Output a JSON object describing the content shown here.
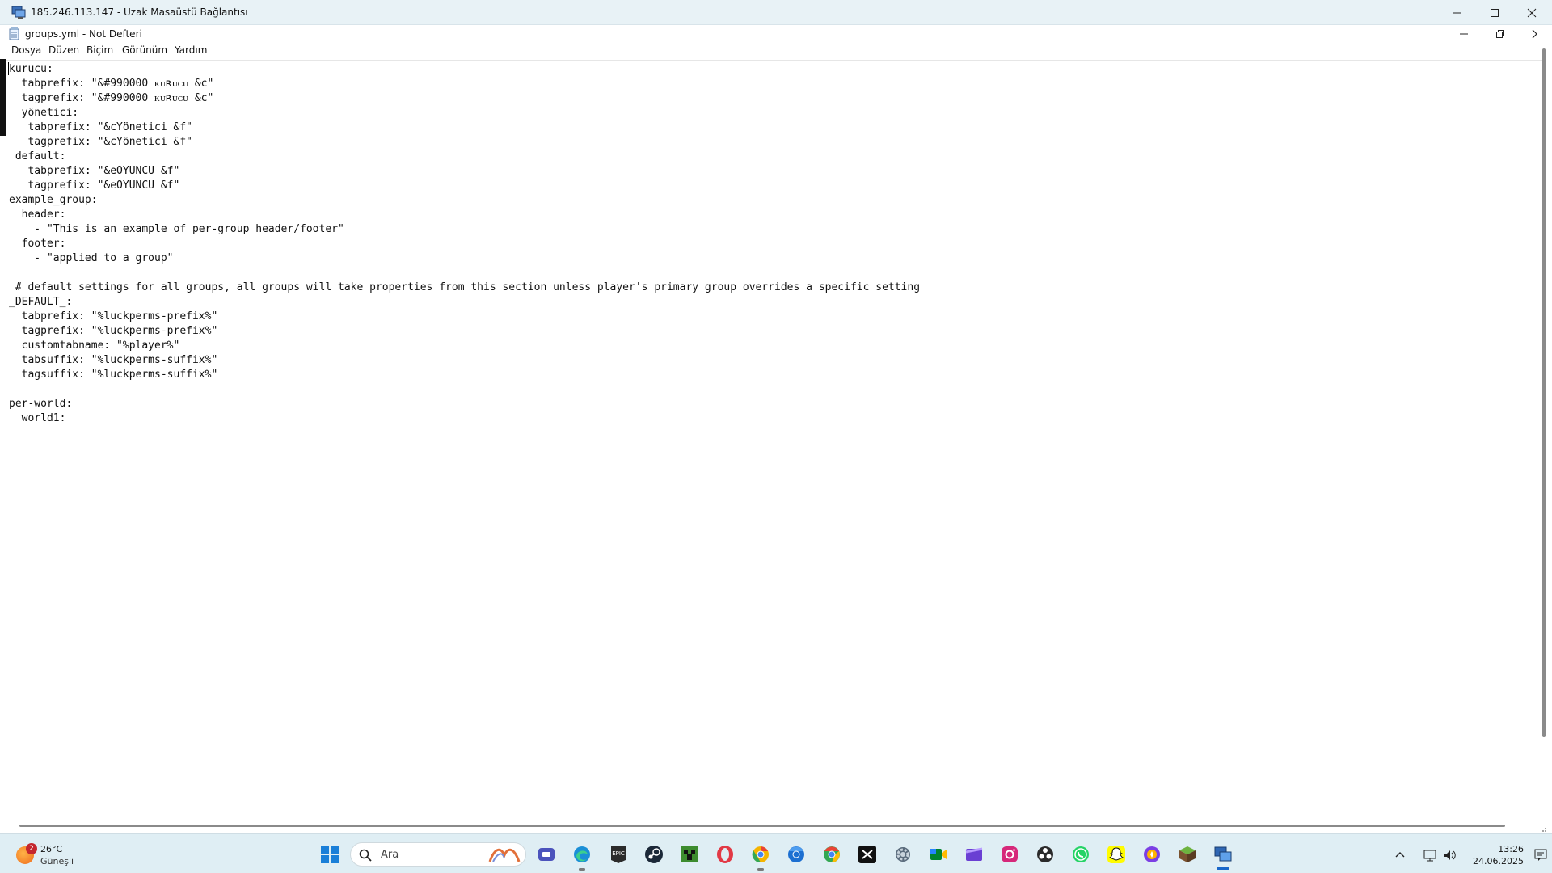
{
  "rdp_window": {
    "title": "185.246.113.147 - Uzak Masaüstü Bağlantısı"
  },
  "notepad": {
    "title": "groups.yml - Not Defteri",
    "menu": [
      "Dosya",
      "Düzen",
      "Biçim",
      "Görünüm",
      "Yardım"
    ],
    "content_lines": [
      "kurucu:",
      "  tabprefix: \"&#990000 ᴋᴜʀᴜᴄᴜ &c\"",
      "  tagprefix: \"&#990000 ᴋᴜʀᴜᴄᴜ &c\"",
      "  yönetici:",
      "   tabprefix: \"&cYönetici &f\"",
      "   tagprefix: \"&cYönetici &f\"",
      " default:",
      "   tabprefix: \"&eOYUNCU &f\"",
      "   tagprefix: \"&eOYUNCU &f\"",
      "example_group:",
      "  header:",
      "    - \"This is an example of per-group header/footer\"",
      "  footer:",
      "    - \"applied to a group\"",
      "",
      " # default settings for all groups, all groups will take properties from this section unless player's primary group overrides a specific setting",
      "_DEFAULT_:",
      "  tabprefix: \"%luckperms-prefix%\"",
      "  tagprefix: \"%luckperms-prefix%\"",
      "  customtabname: \"%player%\"",
      "  tabsuffix: \"%luckperms-suffix%\"",
      "  tagsuffix: \"%luckperms-suffix%\"",
      "",
      "per-world:",
      "  world1:"
    ]
  },
  "taskbar": {
    "weather": {
      "temperature": "26°C",
      "condition": "Güneşli",
      "badge": "2"
    },
    "search_placeholder": "Ara",
    "apps": [
      "teams-meet-icon",
      "edge-icon",
      "epic-games-icon",
      "steam-icon",
      "minecraft-icon",
      "opera-icon",
      "chrome-canary-icon",
      "chrome-dev-icon",
      "chrome-icon",
      "capcut-icon",
      "settings-icon",
      "google-meet-icon",
      "clipchamp-icon",
      "instagram-icon",
      "obs-icon",
      "whatsapp-icon",
      "snapchat-icon",
      "brave-nightly-icon",
      "minecraft-launcher-icon",
      "remote-desktop-icon"
    ],
    "clock": {
      "time": "13:26",
      "date": "24.06.2025"
    }
  },
  "colors": {
    "accent": "#1a67c9",
    "taskbar_bg": "#dfeef4",
    "rdp_titlebar_bg": "#e8f2f6"
  }
}
